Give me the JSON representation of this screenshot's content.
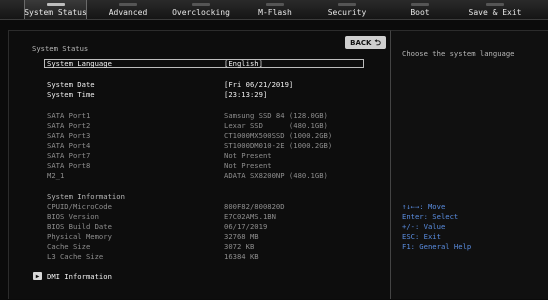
{
  "tabs": [
    {
      "label": "System Status",
      "active": true
    },
    {
      "label": "Advanced",
      "active": false
    },
    {
      "label": "Overclocking",
      "active": false
    },
    {
      "label": "M-Flash",
      "active": false
    },
    {
      "label": "Security",
      "active": false
    },
    {
      "label": "Boot",
      "active": false
    },
    {
      "label": "Save & Exit",
      "active": false
    }
  ],
  "back_button": {
    "label": "BACK",
    "icon": "return-icon"
  },
  "section_title": "System Status",
  "language": {
    "label": "System Language",
    "value": "[English]"
  },
  "date": {
    "label": "System Date",
    "value": "[Fri 06/21/2019]"
  },
  "time": {
    "label": "System Time",
    "value": "[23:13:29]"
  },
  "sata": [
    {
      "label": "SATA Port1",
      "value": "Samsung SSD 84 (128.0GB)"
    },
    {
      "label": "SATA Port2",
      "value": "Lexar SSD      (480.1GB)"
    },
    {
      "label": "SATA Port3",
      "value": "CT1000MX500SSD (1000.2GB)"
    },
    {
      "label": "SATA Port4",
      "value": "ST1000DM010-2E (1000.2GB)"
    },
    {
      "label": "SATA Port7",
      "value": "Not Present"
    },
    {
      "label": "SATA Port8",
      "value": "Not Present"
    },
    {
      "label": "M2_1",
      "value": "ADATA SX8200NP (480.1GB)"
    }
  ],
  "sysinfo": {
    "title": "System Information",
    "rows": [
      {
        "label": "CPUID/MicroCode",
        "value": "800F82/800820D"
      },
      {
        "label": "BIOS Version",
        "value": "E7C02AMS.1BN"
      },
      {
        "label": "BIOS Build Date",
        "value": "06/17/2019"
      },
      {
        "label": "Physical Memory",
        "value": "32768 MB"
      },
      {
        "label": "Cache Size",
        "value": "3072 KB"
      },
      {
        "label": "L3 Cache Size",
        "value": "16384 KB"
      }
    ]
  },
  "dmi": {
    "label": "DMI Information"
  },
  "side": {
    "description": "Choose the system language",
    "help": [
      "↑↓←→: Move",
      "Enter: Select",
      "+/-: Value",
      "ESC: Exit",
      "F1: General Help"
    ]
  }
}
